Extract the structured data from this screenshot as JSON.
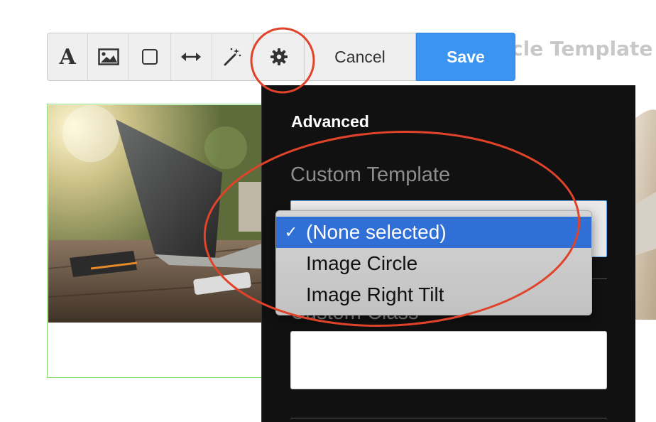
{
  "background_heading": "cle Template",
  "toolbar": {
    "tools": [
      {
        "name": "text-tool",
        "icon": "font-icon",
        "glyph": "A"
      },
      {
        "name": "image-tool",
        "icon": "image-icon"
      },
      {
        "name": "box-tool",
        "icon": "square-icon"
      },
      {
        "name": "width-tool",
        "icon": "double-arrow-icon"
      },
      {
        "name": "magic-tool",
        "icon": "magic-wand-icon"
      },
      {
        "name": "settings-tool",
        "icon": "gear-icon"
      }
    ],
    "cancel_label": "Cancel",
    "save_label": "Save"
  },
  "panel": {
    "title": "Advanced",
    "template_label": "Custom Template",
    "class_label": "Custom Class",
    "class_value": "",
    "template_options": [
      {
        "label": "(None selected)",
        "selected": true
      },
      {
        "label": "Image Circle",
        "selected": false
      },
      {
        "label": "Image Right Tilt",
        "selected": false
      }
    ],
    "check_mark": "✓"
  },
  "colors": {
    "save_button": "#3b94f0",
    "selected_option": "#2f6fd6",
    "annotation": "#e0432a",
    "image_outline": "#7ed66f",
    "panel_bg": "#111111"
  }
}
